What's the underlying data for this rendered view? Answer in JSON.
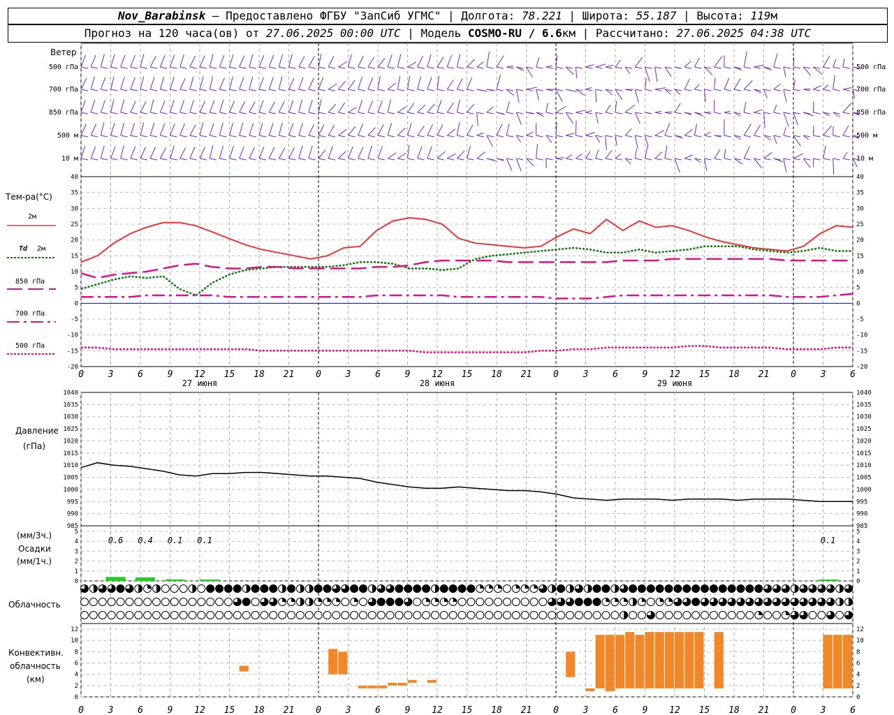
{
  "header": {
    "station": "Nov_Barabinsk",
    "dash": " — ",
    "provider": "Предоставлено ФГБУ \"ЗапСиб УГМС\"",
    "lon_label": "Долгота:",
    "lon": "78.221",
    "lat_label": "Широта:",
    "lat": "55.187",
    "alt_label": "Высота:",
    "alt": "119",
    "alt_unit": "м",
    "forecast_prefix": "Прогноз на 120 часа(ов) от",
    "forecast_start": "27.06.2025 00:00 UTC",
    "model_label": "Модель",
    "model": "COSMO-RU / 6.6",
    "model_unit": "км",
    "calc_label": "Рассчитано:",
    "calc_time": "27.06.2025 04:38 UTC"
  },
  "panels": {
    "wind_title": "Ветер",
    "temp_title": "Тем-ра(°С)",
    "pressure_title": "Давление",
    "pressure_unit": "(гПа)",
    "precip_unit3": "(мм/3ч.)",
    "precip_title": "Осадки",
    "precip_unit1": "(мм/1ч.)",
    "cloud_title": "Облачность",
    "conv_title_1": "Конвективн.",
    "conv_title_2": "облачность",
    "conv_unit": "(км)"
  },
  "legend": {
    "t2m": "2м",
    "td_symbol": "Td",
    "td_level": "2м",
    "t850": "850 гПа",
    "t700": "700 гПа",
    "t500": "500 гПа"
  },
  "colors": {
    "t2m": "#ee3333",
    "td2m": "#0a7a0a",
    "t850": "#dd1188",
    "t700": "#dd1188",
    "t500": "#dd1188",
    "zero_line": "#0000ff",
    "wind_barb": "#7a22cc",
    "pressure": "#000000",
    "precip": "#22cc22",
    "convective": "#f0882a"
  },
  "chart_data": {
    "type": "line",
    "x_hours": [
      0,
      3,
      6,
      9,
      12,
      15,
      18,
      21,
      24,
      27,
      30,
      33,
      36,
      39,
      42,
      45,
      48,
      51,
      54,
      57,
      60,
      63,
      66,
      69,
      72,
      75,
      78
    ],
    "x_tick_labels": [
      "0",
      "3",
      "6",
      "9",
      "12",
      "15",
      "18",
      "21",
      "0",
      "3",
      "6",
      "9",
      "12",
      "15",
      "18",
      "21",
      "0",
      "3",
      "6",
      "9",
      "12",
      "15",
      "18",
      "21",
      "0",
      "3",
      "6"
    ],
    "day_labels": [
      {
        "hour": 12,
        "text": "27 июня"
      },
      {
        "hour": 36,
        "text": "28 июня"
      },
      {
        "hour": 60,
        "text": "29 июня"
      }
    ],
    "wind": {
      "levels": [
        "500 гПа",
        "700 гПа",
        "850 гПа",
        "500 м",
        "10 м"
      ]
    },
    "temperature": {
      "ylim": [
        -20,
        40
      ],
      "yticks": [
        -20,
        -15,
        -10,
        -5,
        0,
        5,
        10,
        15,
        20,
        25,
        30,
        35,
        40
      ],
      "series": [
        {
          "name": "2м",
          "style": "solid",
          "values": [
            13,
            15,
            19,
            22,
            24,
            25.5,
            25.5,
            24.5,
            22.5,
            20.5,
            18.5,
            17,
            16,
            15,
            14,
            15,
            17.5,
            18,
            23,
            26,
            27,
            26.5,
            25,
            20.5,
            19,
            18.5,
            18,
            17.5,
            18,
            21,
            23.5,
            22,
            26.5,
            23,
            26,
            24,
            24.5,
            23,
            21,
            19.5,
            18.5,
            17.5,
            17,
            16.5,
            18,
            22,
            24.5,
            24
          ]
        },
        {
          "name": "Td 2м",
          "style": "dotted",
          "values": [
            4.5,
            6,
            7.5,
            8.5,
            8,
            8.5,
            4.5,
            2.5,
            6.5,
            9,
            10.5,
            11,
            11.5,
            11.5,
            11.5,
            11.5,
            12,
            13,
            13,
            12.5,
            11,
            11,
            10.5,
            11,
            14,
            15,
            15.5,
            16,
            16.5,
            17,
            17.5,
            17,
            16,
            16,
            17,
            16,
            16.5,
            17,
            18,
            18,
            18,
            17,
            16.5,
            16,
            16.5,
            17.5,
            16.5,
            16.5
          ]
        },
        {
          "name": "850 гПа",
          "style": "dashed",
          "values": [
            9.5,
            8,
            9,
            9.5,
            10,
            11,
            12,
            12.5,
            11.5,
            11,
            11,
            11.5,
            11.5,
            11,
            11,
            11,
            11,
            11,
            11.5,
            11.5,
            12,
            13,
            13.5,
            13.5,
            13.5,
            13.5,
            13,
            13,
            13,
            13,
            13,
            13,
            13,
            13.5,
            13.5,
            13.5,
            14,
            14,
            14,
            14,
            14,
            14,
            14,
            13.5,
            13.5,
            13.5,
            13.5,
            13.5
          ]
        },
        {
          "name": "700 гПа",
          "style": "dashdot",
          "values": [
            2,
            2,
            2,
            2,
            2.5,
            2.5,
            2.5,
            2.5,
            2.5,
            2,
            2,
            2,
            2,
            2,
            2,
            2,
            2,
            2,
            2.5,
            2.5,
            2.5,
            2.5,
            2.5,
            2,
            2,
            2,
            2,
            2,
            2,
            1.5,
            1.5,
            1.5,
            2,
            2.5,
            2.5,
            2.5,
            2.5,
            2.5,
            2.5,
            2.5,
            2.5,
            2.5,
            2.5,
            2,
            2,
            2,
            2.5,
            3
          ]
        },
        {
          "name": "500 гПа",
          "style": "dotted-fine",
          "values": [
            -14,
            -14,
            -14.5,
            -14.5,
            -14.5,
            -14.5,
            -14.5,
            -14.5,
            -14.5,
            -14.5,
            -14.5,
            -15,
            -15,
            -15,
            -15,
            -15,
            -15,
            -15,
            -15,
            -15,
            -15,
            -15.5,
            -15.5,
            -15.5,
            -15.5,
            -15.5,
            -15.5,
            -15.5,
            -15,
            -15,
            -14.5,
            -14.5,
            -14,
            -14,
            -14,
            -14,
            -14,
            -13.5,
            -13.5,
            -14,
            -14,
            -14,
            -14,
            -14.5,
            -14.5,
            -14.5,
            -14,
            -14
          ]
        }
      ]
    },
    "pressure": {
      "ylim": [
        985,
        1040
      ],
      "yticks": [
        985,
        990,
        995,
        1000,
        1005,
        1010,
        1015,
        1020,
        1025,
        1030,
        1035,
        1040
      ],
      "values": [
        1009,
        1011,
        1010,
        1009.5,
        1008.5,
        1007.5,
        1006,
        1005.5,
        1006.5,
        1006.5,
        1007,
        1007,
        1006.5,
        1006,
        1005.5,
        1005.5,
        1005,
        1004.5,
        1003,
        1002,
        1001,
        1000.5,
        1000.5,
        1001,
        1000.5,
        1000,
        999.5,
        999.5,
        999,
        998,
        996.5,
        996,
        995.5,
        996,
        996,
        996,
        995.5,
        996,
        996,
        996,
        995.5,
        996,
        996,
        996,
        995.5,
        995,
        995,
        995
      ]
    },
    "precip": {
      "ylim": [
        0,
        5
      ],
      "yticks": [
        0,
        1,
        2,
        3,
        4,
        5
      ],
      "bars": [
        {
          "hour": 3.5,
          "value": 0.4
        },
        {
          "hour": 6.5,
          "value": 0.35
        },
        {
          "hour": 9.5,
          "value": 0.15
        },
        {
          "hour": 13,
          "value": 0.05
        },
        {
          "hour": 75.5,
          "value": 0.1
        }
      ],
      "labels": [
        {
          "hour": 3.5,
          "text": "0.6"
        },
        {
          "hour": 6.5,
          "text": "0.4"
        },
        {
          "hour": 9.5,
          "text": "0.1"
        },
        {
          "hour": 12.5,
          "text": "0.1"
        },
        {
          "hour": 75.5,
          "text": "0.1"
        }
      ]
    },
    "convective": {
      "ylim": [
        0,
        13
      ],
      "yticks": [
        0,
        2,
        4,
        6,
        8,
        10,
        12
      ],
      "bars": [
        {
          "hour": 16.5,
          "base": 4.5,
          "top": 5.5
        },
        {
          "hour": 25.5,
          "base": 4,
          "top": 8.5
        },
        {
          "hour": 26.5,
          "base": 4,
          "top": 8
        },
        {
          "hour": 28.5,
          "base": 1.5,
          "top": 2
        },
        {
          "hour": 29.5,
          "base": 1.5,
          "top": 2
        },
        {
          "hour": 30.5,
          "base": 1.5,
          "top": 2
        },
        {
          "hour": 31.5,
          "base": 2,
          "top": 2.5
        },
        {
          "hour": 32.5,
          "base": 2,
          "top": 2.5
        },
        {
          "hour": 33.5,
          "base": 2.5,
          "top": 3
        },
        {
          "hour": 35.5,
          "base": 2.5,
          "top": 3
        },
        {
          "hour": 49.5,
          "base": 3.5,
          "top": 8
        },
        {
          "hour": 51.5,
          "base": 1,
          "top": 1.5
        },
        {
          "hour": 52.5,
          "base": 1.5,
          "top": 11
        },
        {
          "hour": 53.5,
          "base": 1,
          "top": 11
        },
        {
          "hour": 54.5,
          "base": 1.5,
          "top": 11
        },
        {
          "hour": 55.5,
          "base": 1.5,
          "top": 11.5
        },
        {
          "hour": 56.5,
          "base": 1.5,
          "top": 11
        },
        {
          "hour": 57.5,
          "base": 1.5,
          "top": 11.5
        },
        {
          "hour": 58.5,
          "base": 1.5,
          "top": 11.5
        },
        {
          "hour": 59.5,
          "base": 1.5,
          "top": 11.5
        },
        {
          "hour": 60.5,
          "base": 1.5,
          "top": 11.5
        },
        {
          "hour": 61.5,
          "base": 1.5,
          "top": 11.5
        },
        {
          "hour": 62.5,
          "base": 1.5,
          "top": 11.5
        },
        {
          "hour": 64.5,
          "base": 1.5,
          "top": 11.5
        },
        {
          "hour": 75.5,
          "base": 1.5,
          "top": 11
        },
        {
          "hour": 76.5,
          "base": 1.5,
          "top": 11
        },
        {
          "hour": 77.5,
          "base": 1.5,
          "top": 11
        }
      ]
    },
    "cloudiness": {
      "rows": 3,
      "cover_top": [
        0.75,
        0.5,
        0.75,
        0.75,
        1,
        0.75,
        0.5,
        0.25,
        0.5,
        0,
        0,
        0,
        0.5,
        0,
        1,
        1,
        1,
        1,
        0.5,
        1,
        1,
        1,
        0.5,
        1,
        0.5,
        0.5,
        1,
        1,
        0.75,
        0.75,
        1,
        1,
        0.5,
        0.75,
        0.75,
        1,
        1,
        1,
        1,
        0.5,
        1,
        1,
        1,
        1,
        0.25,
        0.25,
        0.25,
        0,
        0.25,
        0.25,
        0.25,
        0.75,
        0.5,
        1,
        0.5,
        0.75,
        0.5,
        1,
        1,
        0.5,
        0.75,
        1,
        1,
        1,
        1,
        1,
        1,
        1,
        1,
        1,
        1,
        1,
        1,
        1,
        1,
        1,
        0.75,
        0.75,
        0.75,
        0.5,
        0.75,
        0.75,
        0.75,
        0.75,
        0.5,
        0.75
      ],
      "cover_mid": [
        0,
        0,
        0,
        0,
        0,
        0,
        0,
        0,
        0,
        0,
        0,
        0,
        0,
        0,
        0,
        0,
        0,
        0.75,
        1,
        0,
        0.75,
        0.75,
        0.25,
        0.25,
        0.5,
        0.5,
        0.25,
        0.25,
        0.25,
        0,
        0.25,
        0,
        0.75,
        1,
        1,
        1,
        0.75,
        0,
        0.25,
        0.25,
        0.25,
        0.25,
        0,
        0,
        0,
        0,
        0,
        0,
        0,
        0,
        0,
        0,
        0.75,
        0.75,
        0.75,
        1,
        1,
        1,
        0.25,
        0.25,
        0.25,
        0.5,
        0.25,
        0,
        0.25,
        0.25,
        0.75,
        0.75,
        1,
        0.75,
        0.75,
        0.75,
        0.75,
        0.75,
        0.75,
        0.75,
        0.75,
        0.75,
        0.75,
        0.75,
        0.75,
        0.75,
        0.75,
        0.75,
        0.5,
        0.5
      ],
      "cover_low": [
        0,
        0,
        0,
        0,
        0,
        0,
        0,
        0,
        0,
        0,
        0,
        0,
        0,
        0,
        0,
        0,
        0,
        0,
        0,
        0,
        0,
        0,
        0,
        0,
        0,
        0,
        0,
        0,
        0,
        0,
        0,
        0,
        0,
        0,
        0,
        0,
        0,
        0,
        0,
        0,
        0,
        0,
        0,
        0,
        0,
        0,
        0,
        0,
        0,
        0,
        0,
        0,
        0,
        0,
        0,
        0,
        0,
        0,
        0,
        0,
        0.5,
        0,
        0,
        0.75,
        0,
        0,
        0,
        0,
        0,
        0,
        0,
        0,
        0,
        0,
        0,
        0.25,
        0,
        0,
        0.25,
        0.75,
        0.75,
        0,
        0,
        0.75,
        0,
        0.75
      ]
    }
  }
}
